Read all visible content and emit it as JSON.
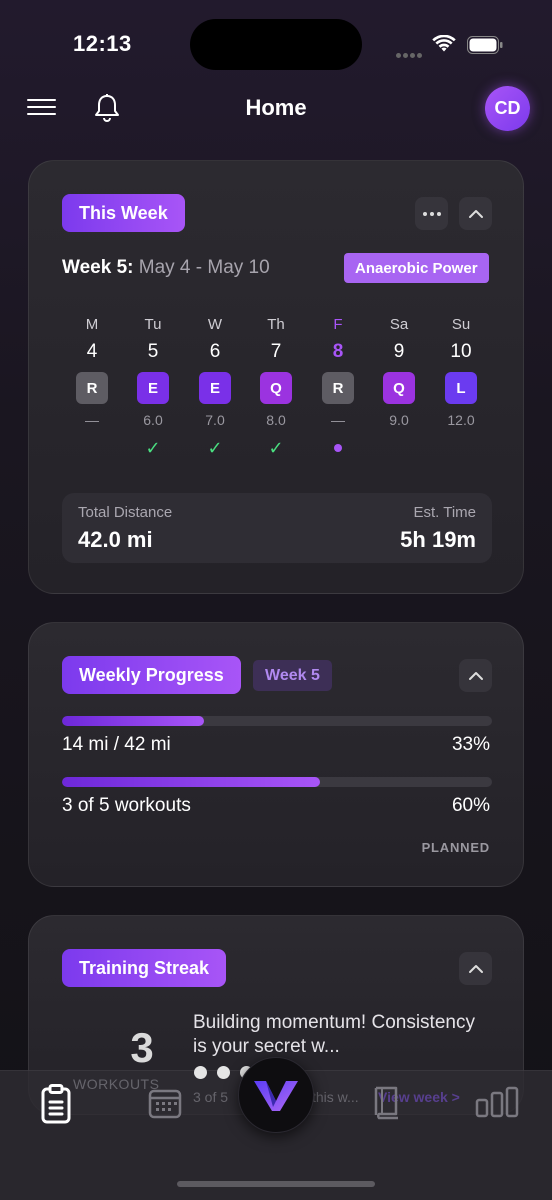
{
  "status_bar": {
    "time": "12:13"
  },
  "header": {
    "title": "Home",
    "avatar_initials": "CD"
  },
  "this_week": {
    "pill": "This Week",
    "week_label": "Week 5:",
    "date_range": "May 4 - May 10",
    "phase": "Anaerobic Power",
    "days": [
      {
        "name": "M",
        "date": "4",
        "type": "R",
        "distance": "—",
        "status": "none",
        "today": false
      },
      {
        "name": "Tu",
        "date": "5",
        "type": "E",
        "distance": "6.0",
        "status": "done",
        "today": false
      },
      {
        "name": "W",
        "date": "6",
        "type": "E",
        "distance": "7.0",
        "status": "done",
        "today": false
      },
      {
        "name": "Th",
        "date": "7",
        "type": "Q",
        "distance": "8.0",
        "status": "done",
        "today": false
      },
      {
        "name": "F",
        "date": "8",
        "type": "R",
        "distance": "—",
        "status": "today",
        "today": true
      },
      {
        "name": "Sa",
        "date": "9",
        "type": "Q",
        "distance": "9.0",
        "status": "none",
        "today": false
      },
      {
        "name": "Su",
        "date": "10",
        "type": "L",
        "distance": "12.0",
        "status": "none",
        "today": false
      }
    ],
    "total_distance_label": "Total Distance",
    "total_distance": "42.0 mi",
    "est_time_label": "Est. Time",
    "est_time": "5h 19m"
  },
  "weekly_progress": {
    "pill": "Weekly Progress",
    "week_chip": "Week 5",
    "distance_text": "14 mi / 42 mi",
    "distance_pct": "33%",
    "distance_fraction": 0.33,
    "workouts_text": "3 of 5 workouts",
    "workouts_pct": "60%",
    "workouts_fraction": 0.6,
    "footer": "PLANNED"
  },
  "training_streak": {
    "pill": "Training Streak",
    "count": "3",
    "count_label": "WORKOUTS",
    "message": "Building momentum! Consistency is your secret w...",
    "partial_left": "3 of 5",
    "partial_mid": "this w...",
    "view_week_link": "View week >"
  },
  "tabbar": {
    "items": [
      {
        "icon": "clipboard-icon",
        "active": true
      },
      {
        "icon": "calendar-icon",
        "active": false
      },
      {
        "icon": "logo-v-icon",
        "active": false
      },
      {
        "icon": "book-icon",
        "active": false
      },
      {
        "icon": "bar-chart-icon",
        "active": false
      }
    ]
  }
}
